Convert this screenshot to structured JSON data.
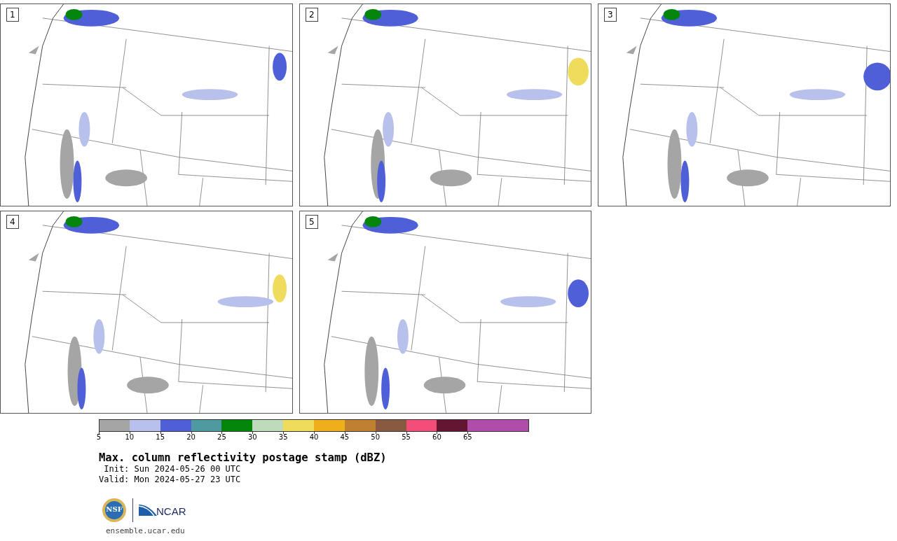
{
  "panels": [
    {
      "label": "1"
    },
    {
      "label": "2"
    },
    {
      "label": "3"
    },
    {
      "label": "4"
    },
    {
      "label": "5"
    }
  ],
  "colorbar": {
    "segments": [
      {
        "color": "#a5a5a5",
        "tick": "5"
      },
      {
        "color": "#b7c1ec",
        "tick": "10"
      },
      {
        "color": "#4f5fd8",
        "tick": "15"
      },
      {
        "color": "#4f9aa0",
        "tick": "20"
      },
      {
        "color": "#03860b",
        "tick": "25"
      },
      {
        "color": "#bedcbc",
        "tick": "30"
      },
      {
        "color": "#f0dc5c",
        "tick": "35"
      },
      {
        "color": "#efaf1c",
        "tick": "40"
      },
      {
        "color": "#bd8131",
        "tick": "45"
      },
      {
        "color": "#8a5a40",
        "tick": "50"
      },
      {
        "color": "#f34e7a",
        "tick": "55"
      },
      {
        "color": "#621632",
        "tick": "60"
      },
      {
        "color": "#ad4fa8",
        "tick": "65"
      },
      {
        "color": "#ad4fa8"
      }
    ]
  },
  "title": "Max. column reflectivity postage stamp (dBZ)",
  "init": " Init: Sun 2024-05-26 00 UTC",
  "valid": "Valid: Mon 2024-05-27 23 UTC",
  "logos": {
    "nsf": "NSF",
    "ncar": "NCAR"
  },
  "footer": "ensemble.ucar.edu"
}
